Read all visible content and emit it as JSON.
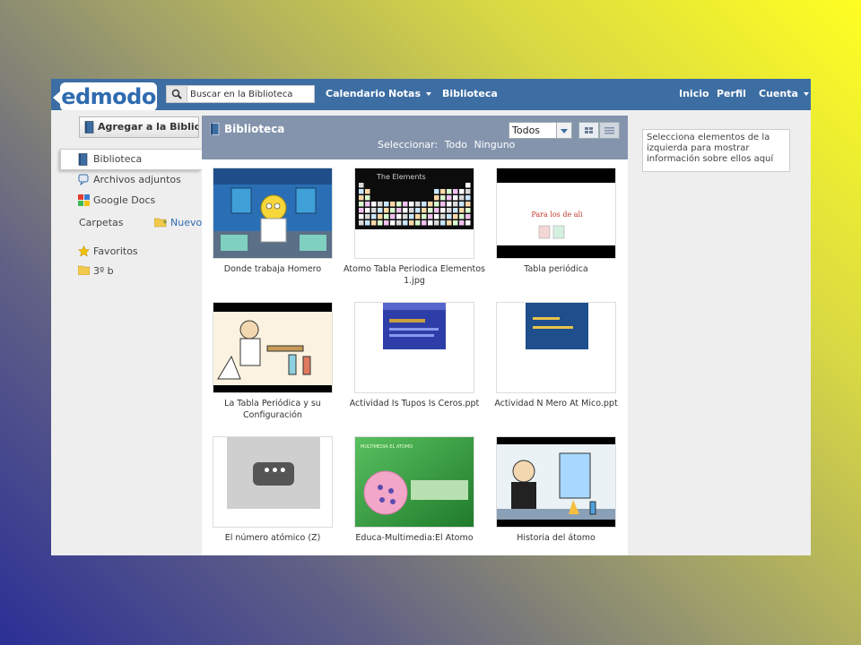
{
  "header": {
    "logo": "edmodo",
    "search_placeholder": "Buscar en la Biblioteca",
    "nav_left": [
      "Calendario",
      "Notas",
      "Biblioteca"
    ],
    "nav_right": [
      "Inicio",
      "Perfil",
      "Cuenta"
    ]
  },
  "sidebar": {
    "add_button": "Agregar a la Biblioteca",
    "items": [
      {
        "label": "Biblioteca",
        "icon": "book-icon"
      },
      {
        "label": "Archivos adjuntos",
        "icon": "paperclip-icon"
      },
      {
        "label": "Google Docs",
        "icon": "google-docs-icon"
      }
    ],
    "folders_label": "Carpetas",
    "new_folder": "Nuevo",
    "folders": [
      {
        "label": "Favoritos",
        "icon": "star-icon"
      },
      {
        "label": "3º b",
        "icon": "folder-icon"
      }
    ]
  },
  "panel": {
    "title": "Biblioteca",
    "filter_value": "Todos",
    "select_label": "Seleccionar:",
    "select_all": "Todo",
    "select_none": "Ninguno",
    "items": [
      "Donde trabaja Homero",
      "Atomo Tabla Periodica Elementos 1.jpg",
      "Tabla periódica",
      "La Tabla Periódica y su Configuración",
      "Actividad Is Tupos Is Ceros.ppt",
      "Actividad N Mero At Mico.ppt",
      "El número atómico (Z)",
      "Educa-Multimedia:El Atomo",
      "Historia del átomo"
    ],
    "thumb_texts": {
      "elements": "The Elements",
      "tabla": "Para los de ali",
      "atomo_slide": "MULTIMEDIA EL ATOMO",
      "video_dots": "•••"
    }
  },
  "right_panel": {
    "hint": "Selecciona elementos de la izquierda para mostrar información sobre ellos aquí"
  },
  "colors": {
    "topbar": "#3d6ea3",
    "panel_header": "#8494ad"
  }
}
